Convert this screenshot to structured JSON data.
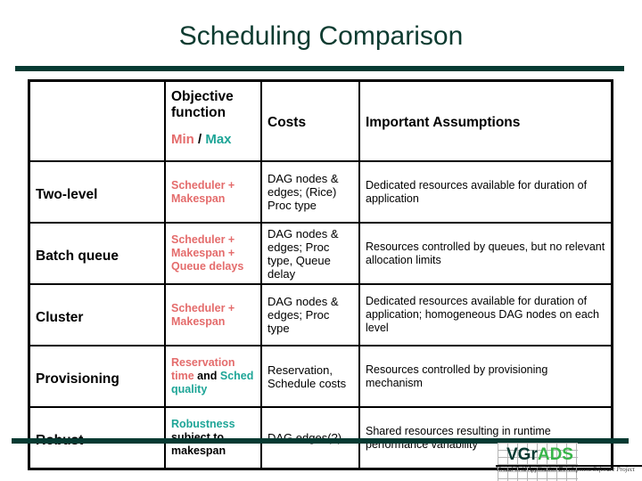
{
  "slide": {
    "title": "Scheduling Comparison"
  },
  "table": {
    "header": {
      "objective": "Objective function",
      "min_label": "Min",
      "separator": " / ",
      "max_label": "Max",
      "costs": "Costs",
      "assumptions": "Important Assumptions"
    },
    "rows": [
      {
        "name": "Two-level",
        "objective": [
          {
            "text": "Scheduler + Makespan",
            "tone": "min"
          }
        ],
        "costs": "DAG nodes & edges; (Rice) Proc type",
        "assumptions": "Dedicated resources available for duration of application"
      },
      {
        "name": "Batch queue",
        "objective": [
          {
            "text": "Scheduler + Makespan + Queue delays",
            "tone": "min"
          }
        ],
        "costs": "DAG nodes & edges; Proc type, Queue delay",
        "assumptions": "Resources controlled by queues, but no relevant allocation limits"
      },
      {
        "name": "Cluster",
        "objective": [
          {
            "text": "Scheduler + Makespan",
            "tone": "min"
          }
        ],
        "costs": "DAG nodes & edges; Proc type",
        "assumptions": "Dedicated resources available for duration of application; homogeneous DAG nodes on each level"
      },
      {
        "name": "Provisioning",
        "objective": [
          {
            "text": "Reservation time",
            "tone": "min"
          },
          {
            "text": " and ",
            "tone": "plain"
          },
          {
            "text": "Sched quality",
            "tone": "max"
          }
        ],
        "costs": "Reservation, Schedule costs",
        "assumptions": "Resources controlled by provisioning mechanism"
      },
      {
        "name": "Robust",
        "objective": [
          {
            "text": "Robustness",
            "tone": "max"
          },
          {
            "text": " subject to makespan",
            "tone": "plain"
          }
        ],
        "costs": "DAG edges(?)",
        "assumptions": "Shared resources resulting in runtime performance variability"
      }
    ]
  },
  "logo": {
    "part1": "VGr",
    "part2": "ADS",
    "subtitle": "Virtual Grid Application Development Software Project"
  },
  "colors": {
    "min": "#e46c6c",
    "max": "#1ea597",
    "brand_dark": "#063a32",
    "brand_light": "#39b54a"
  }
}
